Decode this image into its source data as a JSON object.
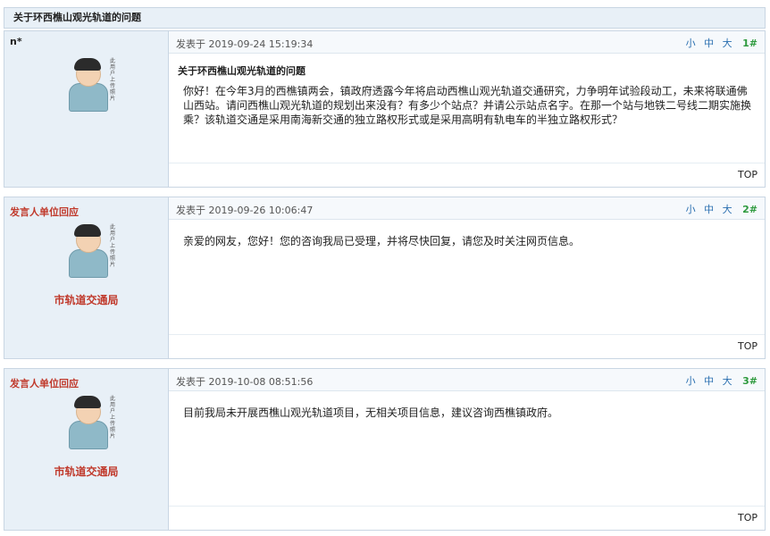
{
  "thread": {
    "title": "关于环西樵山观光轨道的问题"
  },
  "posts": [
    {
      "author": "n*",
      "time": "发表于 2019-09-24 15:19:34",
      "size_small": "小",
      "size_medium": "中",
      "size_large": "大",
      "floor": "1#",
      "title": "关于环西樵山观光轨道的问题",
      "text": "你好！在今年3月的西樵镇两会，镇政府透露今年将启动西樵山观光轨道交通研究，力争明年试验段动工，未来将联通佛山西站。请问西樵山观光轨道的规划出来没有？有多少个站点？并请公示站点名字。在那一个站与地铁二号线二期实施换乘？该轨道交通是采用南海新交通的独立路权形式或是采用高明有轨电车的半独立路权形式？",
      "top": "TOP"
    },
    {
      "author": "发言人单位回应",
      "dept": "市轨道交通局",
      "time": "发表于 2019-09-26 10:06:47",
      "size_small": "小",
      "size_medium": "中",
      "size_large": "大",
      "floor": "2#",
      "text": "亲爱的网友，您好！您的咨询我局已受理，并将尽快回复，请您及时关注网页信息。",
      "top": "TOP"
    },
    {
      "author": "发言人单位回应",
      "dept": "市轨道交通局",
      "time": "发表于 2019-10-08 08:51:56",
      "size_small": "小",
      "size_medium": "中",
      "size_large": "大",
      "floor": "3#",
      "text": "目前我局未开展西樵山观光轨道项目，无相关项目信息，建议咨询西樵镇政府。",
      "top": "TOP"
    }
  ],
  "avatar": {
    "caption": "此用户上传照片"
  }
}
